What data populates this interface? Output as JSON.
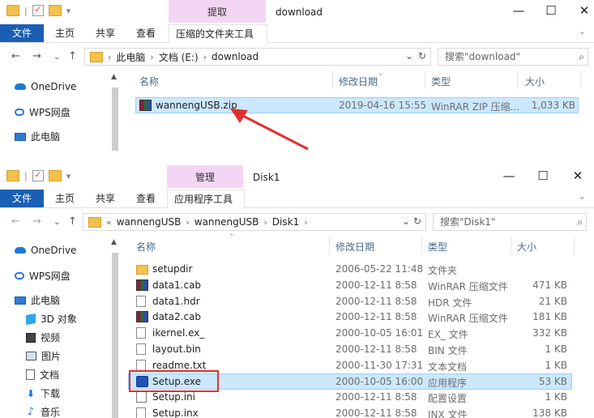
{
  "windows": [
    {
      "id": "win1",
      "title": "download",
      "context_tab": "提取",
      "ribbon_tabs": [
        "文件",
        "主页",
        "共享",
        "查看",
        "压缩的文件夹工具"
      ],
      "address": [
        "此电脑",
        "文档 (E:)",
        "download"
      ],
      "search_placeholder": "搜索\"download\"",
      "sidebar": [
        {
          "label": "OneDrive",
          "icon": "onedrive-icon"
        },
        {
          "label": "WPS网盘",
          "icon": "wps-cloud-icon"
        },
        {
          "label": "此电脑",
          "icon": "this-pc-icon"
        }
      ],
      "columns": [
        "名称",
        "修改日期",
        "类型",
        "大小"
      ],
      "files": [
        {
          "name": "wannengUSB.zip",
          "date": "2019-04-16 15:55",
          "type": "WinRAR ZIP 压缩...",
          "size": "1,033 KB",
          "icon": "rar",
          "selected": true
        }
      ]
    },
    {
      "id": "win2",
      "title": "Disk1",
      "context_tab": "管理",
      "ribbon_tabs": [
        "文件",
        "主页",
        "共享",
        "查看",
        "应用程序工具"
      ],
      "address_prefix": "«",
      "address": [
        "wannengUSB",
        "wannengUSB",
        "Disk1"
      ],
      "search_placeholder": "搜索\"Disk1\"",
      "sidebar": [
        {
          "label": "OneDrive",
          "icon": "onedrive-icon"
        },
        {
          "label": "WPS网盘",
          "icon": "wps-cloud-icon"
        },
        {
          "label": "此电脑",
          "icon": "this-pc-icon"
        },
        {
          "label": "3D 对象",
          "icon": "3d-objects-icon"
        },
        {
          "label": "视频",
          "icon": "video-icon"
        },
        {
          "label": "图片",
          "icon": "pictures-icon"
        },
        {
          "label": "文档",
          "icon": "documents-icon"
        },
        {
          "label": "下载",
          "icon": "download-icon"
        },
        {
          "label": "音乐",
          "icon": "music-icon"
        }
      ],
      "columns": [
        "名称",
        "修改日期",
        "类型",
        "大小"
      ],
      "files": [
        {
          "name": "setupdir",
          "date": "2006-05-22 11:48",
          "type": "文件夹",
          "size": "",
          "icon": "folder"
        },
        {
          "name": "data1.cab",
          "date": "2000-12-11 8:58",
          "type": "WinRAR 压缩文件",
          "size": "471 KB",
          "icon": "rar"
        },
        {
          "name": "data1.hdr",
          "date": "2000-12-11 8:58",
          "type": "HDR 文件",
          "size": "21 KB",
          "icon": "generic"
        },
        {
          "name": "data2.cab",
          "date": "2000-12-11 8:58",
          "type": "WinRAR 压缩文件",
          "size": "181 KB",
          "icon": "rar"
        },
        {
          "name": "ikernel.ex_",
          "date": "2000-10-05 16:01",
          "type": "EX_ 文件",
          "size": "332 KB",
          "icon": "generic"
        },
        {
          "name": "layout.bin",
          "date": "2000-12-11 8:58",
          "type": "BIN 文件",
          "size": "1 KB",
          "icon": "generic"
        },
        {
          "name": "readme.txt",
          "date": "2000-11-30 17:31",
          "type": "文本文档",
          "size": "1 KB",
          "icon": "generic"
        },
        {
          "name": "Setup.exe",
          "date": "2000-10-05 16:00",
          "type": "应用程序",
          "size": "53 KB",
          "icon": "setup",
          "selected": true
        },
        {
          "name": "Setup.ini",
          "date": "2000-12-11 8:58",
          "type": "配置设置",
          "size": "1 KB",
          "icon": "ini"
        },
        {
          "name": "Setup.inx",
          "date": "2000-12-11 8:58",
          "type": "INX 文件",
          "size": "138 KB",
          "icon": "generic"
        }
      ]
    }
  ],
  "window_controls": {
    "minimize": "—",
    "maximize": "☐",
    "close": "✕"
  },
  "colors": {
    "file_tab": "#1b5fb5",
    "context_tab": "#f4d6f4",
    "selection": "#cce8ff",
    "annotation": "#e23030"
  }
}
